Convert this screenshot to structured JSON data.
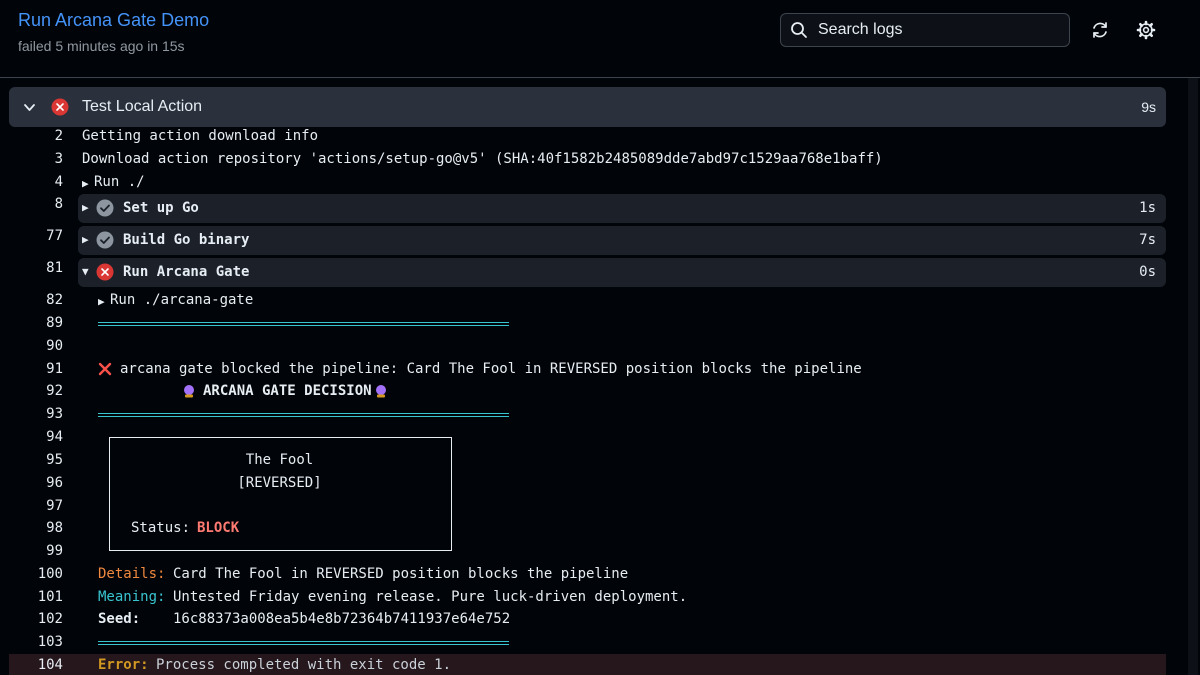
{
  "header": {
    "title": "Run Arcana Gate Demo",
    "subtitle": "failed 5 minutes ago in 15s",
    "search_placeholder": "Search logs"
  },
  "job_step": {
    "name": "Test Local Action",
    "duration": "9s",
    "status": "failed"
  },
  "log": {
    "l2": {
      "num": "2",
      "text": "Getting action download info"
    },
    "l3": {
      "num": "3",
      "text": "Download action repository 'actions/setup-go@v5' (SHA:40f1582b2485089dde7abd97c1529aa768e1baff)"
    },
    "l4": {
      "num": "4",
      "text": "Run ./"
    },
    "s8": {
      "num": "8",
      "name": "Set up Go",
      "duration": "1s",
      "status": "success"
    },
    "s77": {
      "num": "77",
      "name": "Build Go binary",
      "duration": "7s",
      "status": "success"
    },
    "s81": {
      "num": "81",
      "name": "Run Arcana Gate",
      "duration": "0s",
      "status": "failed"
    },
    "l82": {
      "num": "82",
      "text": "Run ./arcana-gate"
    },
    "l89": {
      "num": "89"
    },
    "l90": {
      "num": "90"
    },
    "l91": {
      "num": "91",
      "text": "arcana gate blocked the pipeline: Card The Fool in REVERSED position blocks the pipeline"
    },
    "l92": {
      "num": "92",
      "text": "ARCANA GATE DECISION"
    },
    "l93": {
      "num": "93"
    },
    "l94": {
      "num": "94"
    },
    "l95": {
      "num": "95",
      "text": "The Fool"
    },
    "l96": {
      "num": "96",
      "text": "[REVERSED]"
    },
    "l97": {
      "num": "97"
    },
    "l98": {
      "num": "98",
      "label": "Status:",
      "value": "BLOCK"
    },
    "l99": {
      "num": "99"
    },
    "l100": {
      "num": "100",
      "label": "Details:",
      "text": "Card The Fool in REVERSED position blocks the pipeline"
    },
    "l101": {
      "num": "101",
      "label": "Meaning:",
      "text": "Untested Friday evening release. Pure luck-driven deployment."
    },
    "l102": {
      "num": "102",
      "label": "Seed:",
      "text": "16c88373a008ea5b4e8b72364b7411937e64e752"
    },
    "l103": {
      "num": "103"
    },
    "l104": {
      "num": "104",
      "label": "Error:",
      "text": "Process completed with exit code 1."
    }
  },
  "icons": {
    "search": "search-icon",
    "refresh": "refresh-icon",
    "settings": "gear-icon",
    "error": "x-circle-icon",
    "success": "check-circle-icon",
    "crystal_ball": "crystal-ball-icon"
  },
  "colors": {
    "link": "#4493f8",
    "error": "#da3633",
    "success": "#8d96a0",
    "accent_cyan": "#39c5cf",
    "accent_orange": "#f0883e",
    "block_red": "#ff7b72"
  }
}
